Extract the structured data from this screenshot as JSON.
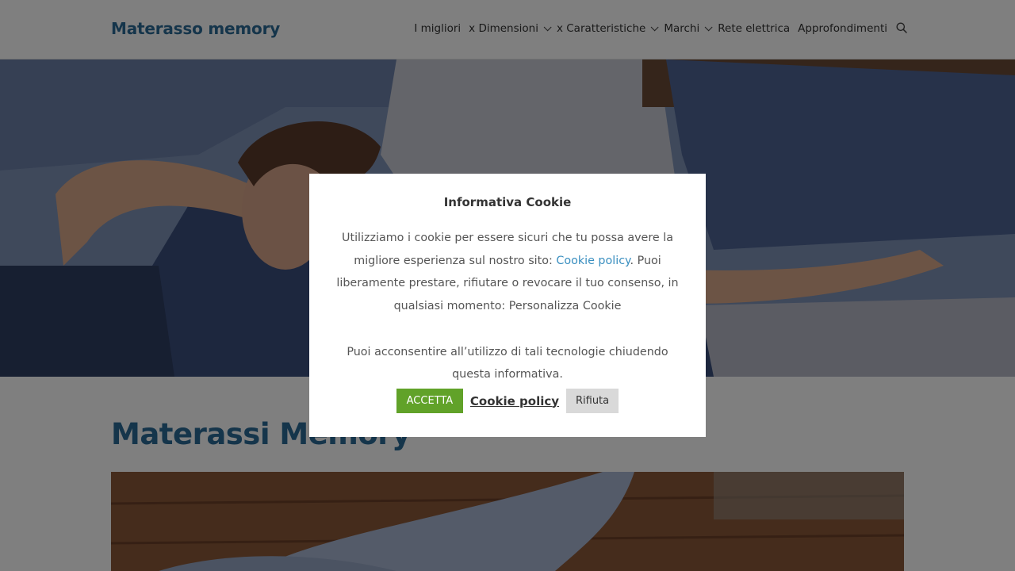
{
  "header": {
    "logo": "Materasso memory",
    "nav": [
      {
        "label": "I migliori",
        "dropdown": false
      },
      {
        "label": "x Dimensioni",
        "dropdown": true
      },
      {
        "label": "x Caratteristiche",
        "dropdown": true
      },
      {
        "label": "Marchi",
        "dropdown": true
      },
      {
        "label": "Rete elettrica",
        "dropdown": false
      },
      {
        "label": "Approfondimenti",
        "dropdown": false
      }
    ],
    "search_icon": "search-icon"
  },
  "main": {
    "title": "Materassi Memory"
  },
  "cookie_modal": {
    "title": "Informativa Cookie",
    "text1_before_link": "Utilizziamo i cookie per essere sicuri che tu possa avere la migliore esperienza sul nostro sito: ",
    "text1_link": "Cookie policy",
    "text1_after_link": ". Puoi liberamente prestare, rifiutare o revocare il tuo consenso, in qualsiasi momento:  Personalizza Cookie",
    "text2": "Puoi acconsentire all’utilizzo di tali tecnologie chiudendo questa informativa.",
    "accept_label": "ACCETTA",
    "policy_label": "Cookie policy",
    "reject_label": "Rifiuta"
  },
  "colors": {
    "brand": "#2b6a96",
    "accept": "#61a229",
    "link": "#3a8fc0"
  }
}
